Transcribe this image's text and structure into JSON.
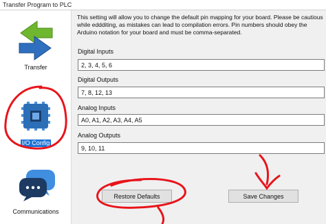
{
  "window": {
    "title": "Transfer Program to PLC"
  },
  "sidebar": {
    "items": [
      {
        "label": "Transfer",
        "icon": "transfer-arrows-icon"
      },
      {
        "label": "I/O Config",
        "icon": "chip-board-icon",
        "selected": true
      },
      {
        "label": "Communications",
        "icon": "chat-bubbles-icon"
      }
    ]
  },
  "main": {
    "description": "This setting will allow you to change the default pin mapping for your board. Please be cautious while eddditing, as mistakes can lead to compilation errors. Pin numbers should obey the Arduino notation for your board and must be comma-separated.",
    "fields": [
      {
        "label": "Digital Inputs",
        "value": "2, 3, 4, 5, 6"
      },
      {
        "label": "Digital Outputs",
        "value": "7, 8, 12, 13"
      },
      {
        "label": "Analog Inputs",
        "value": "A0, A1, A2, A3, A4, A5"
      },
      {
        "label": "Analog Outputs",
        "value": "9, 10, 11"
      }
    ],
    "buttons": {
      "restore": "Restore Defaults",
      "save": "Save Changes"
    }
  },
  "colors": {
    "selection": "#1e73d7",
    "annotation": "#e8141b",
    "content_bg": "#f0f0f0"
  }
}
